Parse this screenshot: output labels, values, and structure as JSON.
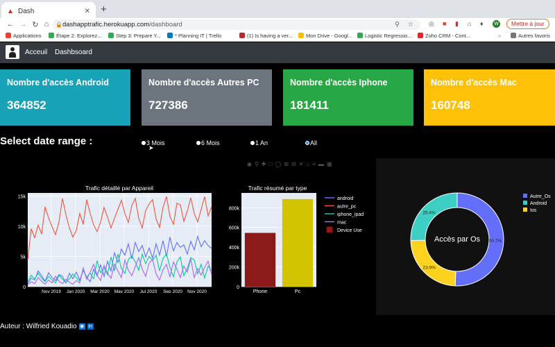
{
  "browser": {
    "tab_title": "Dash",
    "url_domain": "dashapptrafic.herokuapp.com",
    "url_path": "/dashboard",
    "update_button": "Mettre à jour",
    "bookmarks": [
      {
        "label": "Applications",
        "color": "#ea4335"
      },
      {
        "label": "Étape 2: Explorez...",
        "color": "#34a853"
      },
      {
        "label": "Step 3: Prepare Y...",
        "color": "#34a853"
      },
      {
        "label": "* Planning IT | Trello",
        "color": "#0079bf"
      },
      {
        "label": "(1) Is having a ver...",
        "color": "#b92b27"
      },
      {
        "label": "Mon Drive - Googl...",
        "color": "#fbbc04"
      },
      {
        "label": "Logistic Regressio...",
        "color": "#34a853"
      },
      {
        "label": "Zoho CRM - Cont...",
        "color": "#e42527"
      },
      {
        "label": "Autres favoris",
        "color": "#777777"
      }
    ]
  },
  "nav": {
    "links": [
      "Acceuil",
      "Dashbsoard"
    ]
  },
  "cards": [
    {
      "title": "Nombre d'accès Android",
      "value": "364852",
      "color": "#17a2b8"
    },
    {
      "title": "Nombre d'accès Autres PC",
      "value": "727386",
      "color": "#6c757d"
    },
    {
      "title": "Nombre d'accès Iphone",
      "value": "181411",
      "color": "#28a745"
    },
    {
      "title": "Nombre d'accès Mac",
      "value": "160748",
      "color": "#ffc107"
    }
  ],
  "date_range": {
    "label": "Select date range :",
    "options": [
      "3 Mois",
      "6 Mois",
      "1 An",
      "All"
    ],
    "selected": "All"
  },
  "chart_data": [
    {
      "type": "line",
      "title": "Trafic détaillé par Appareil",
      "x_ticks": [
        "Nov 2019",
        "Jan 2020",
        "Mar 2020",
        "May 2020",
        "Jul 2020",
        "Sep 2020",
        "Nov 2020"
      ],
      "y_ticks": [
        "0",
        "5k",
        "10k",
        "15k"
      ],
      "ylim": [
        0,
        15500
      ],
      "series": [
        {
          "name": "android",
          "color": "#636efa",
          "values": [
            500,
            1400,
            1100,
            2600,
            1800,
            900,
            2300,
            1500,
            1000,
            2000,
            1700,
            600,
            2200,
            1300,
            2400,
            1100,
            2700,
            1500,
            800,
            2900,
            1800,
            3600,
            1700,
            4200,
            2600,
            5600,
            4000,
            6200,
            5200,
            7100,
            4600,
            7300,
            5800,
            6800,
            4900,
            6400,
            4700,
            7100,
            5200,
            7600,
            5000,
            8200,
            5900,
            7300,
            6500,
            6900,
            5400,
            7500,
            6100,
            8300,
            6600,
            7600,
            6800,
            6300
          ]
        },
        {
          "name": "autre_pc",
          "color": "#ef553b",
          "values": [
            4500,
            9600,
            8100,
            10200,
            8700,
            13200,
            11400,
            9900,
            8600,
            10700,
            14600,
            11900,
            9700,
            8200,
            9300,
            12100,
            10300,
            14400,
            12100,
            10200,
            9100,
            10700,
            13100,
            11500,
            9700,
            11300,
            12800,
            14300,
            12100,
            10600,
            13400,
            14600,
            11300,
            9700,
            12600,
            13700,
            14400,
            11200,
            9800,
            13100,
            14900,
            11600,
            10300,
            13800,
            13500,
            10800,
            12500,
            14700,
            12100,
            10700,
            12800,
            14900,
            11700,
            13200
          ]
        },
        {
          "name": "iphone_ipad",
          "color": "#00cc96",
          "values": [
            800,
            1900,
            1300,
            2200,
            1400,
            800,
            1700,
            1100,
            600,
            1900,
            1200,
            700,
            1300,
            2100,
            1500,
            900,
            2700,
            1600,
            2200,
            1300,
            4300,
            2300,
            3100,
            2000,
            4900,
            2600,
            5400,
            3000,
            2200,
            4500,
            5100,
            4100,
            2700,
            5400,
            3800,
            5000,
            4300,
            5200,
            2600,
            4700,
            5400,
            3200,
            1600,
            4100,
            4900,
            1800,
            3000,
            4800,
            4400,
            2100,
            3700,
            1400,
            3400,
            2700
          ]
        },
        {
          "name": "mac",
          "color": "#ab63fa",
          "values": [
            300,
            800,
            500,
            1500,
            900,
            400,
            1100,
            600,
            1700,
            900,
            500,
            1200,
            700,
            400,
            1000,
            600,
            3100,
            1200,
            2400,
            3700,
            1900,
            1000,
            3500,
            2200,
            1400,
            3700,
            2600,
            1500,
            4400,
            2700,
            1800,
            3300,
            4800,
            2900,
            1700,
            3900,
            4500,
            2100,
            1100,
            2800,
            3700,
            1600,
            4100,
            2900,
            1500,
            3400,
            2400,
            4600,
            1500,
            3000,
            1900,
            3200,
            4200,
            2000
          ]
        }
      ]
    },
    {
      "type": "bar",
      "title": "Trafic résumé par type",
      "categories": [
        "Phone",
        "Pc"
      ],
      "values": [
        545000,
        888000
      ],
      "colors": [
        "#8b1a1a",
        "#d4c400"
      ],
      "y_ticks": [
        "0",
        "200k",
        "400k",
        "600k",
        "800k"
      ],
      "ylim": [
        0,
        950000
      ],
      "legend": [
        {
          "name": "android",
          "color": "#636efa",
          "kind": "line"
        },
        {
          "name": "autre_pc",
          "color": "#ef553b",
          "kind": "line"
        },
        {
          "name": "iphone_ipad",
          "color": "#00cc96",
          "kind": "line"
        },
        {
          "name": "mac",
          "color": "#ab63fa",
          "kind": "line"
        },
        {
          "name": "Device Use",
          "color": "#8b1a1a",
          "kind": "box"
        }
      ]
    },
    {
      "type": "pie",
      "center_label": "Accès par Os",
      "slices": [
        {
          "name": "Autre_Os",
          "value": 50.7,
          "label": "50.7%",
          "color": "#636efa"
        },
        {
          "name": "Ios",
          "value": 23.9,
          "label": "23.9%",
          "color": "#ffd21f"
        },
        {
          "name": "Android",
          "value": 25.4,
          "label": "25.4%",
          "color": "#3dcfc4"
        }
      ],
      "legend": [
        "Autre_Os",
        "Android",
        "Ios"
      ],
      "legend_colors": [
        "#636efa",
        "#3dcfc4",
        "#ffd21f"
      ]
    }
  ],
  "footer": {
    "text": "Auteur : Wilfried Kouadio"
  }
}
